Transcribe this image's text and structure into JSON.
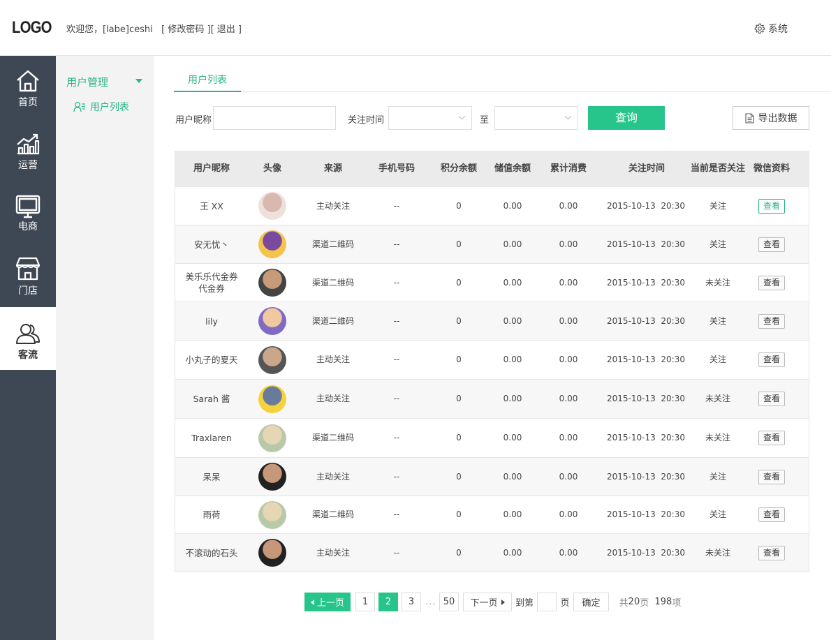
{
  "header": {
    "logo": "LOGO",
    "welcome": "欢迎您，[labe]ceshi",
    "change_password": "[ 修改密码 ]",
    "logout": "[ 退出 ]",
    "system": "系统"
  },
  "nav": {
    "items": [
      {
        "label": "首页",
        "icon": "home-icon"
      },
      {
        "label": "运营",
        "icon": "chart-icon"
      },
      {
        "label": "电商",
        "icon": "monitor-icon"
      },
      {
        "label": "门店",
        "icon": "store-icon"
      },
      {
        "label": "客流",
        "icon": "users-icon",
        "active": true
      }
    ]
  },
  "subnav": {
    "title": "用户管理",
    "item": "用户列表"
  },
  "tab": "用户列表",
  "filters": {
    "nickname_label": "用户昵称",
    "nickname_value": "",
    "time_label": "关注时间",
    "to_label": "至",
    "query_button": "查询",
    "export_button": "导出数据"
  },
  "table": {
    "headers": [
      "用户昵称",
      "头像",
      "来源",
      "手机号码",
      "积分余额",
      "储值余额",
      "累计消费",
      "关注时间",
      "当前是否关注",
      "微信资料"
    ],
    "rows": [
      {
        "name": "王 XX",
        "source": "主动关注",
        "phone": "--",
        "points": "0",
        "balance": "0.00",
        "spent": "0.00",
        "time": "2015-10-13  20:30",
        "follow": "关注",
        "action": "查看"
      },
      {
        "name": "安无忧丶",
        "source": "渠道二维码",
        "phone": "--",
        "points": "0",
        "balance": "0.00",
        "spent": "0.00",
        "time": "2015-10-13  20:30",
        "follow": "关注",
        "action": "查看"
      },
      {
        "name": "美乐乐代金券代金券",
        "source": "渠道二维码",
        "phone": "--",
        "points": "0",
        "balance": "0.00",
        "spent": "0.00",
        "time": "2015-10-13  20:30",
        "follow": "未关注",
        "action": "查看"
      },
      {
        "name": "lily",
        "source": "渠道二维码",
        "phone": "--",
        "points": "0",
        "balance": "0.00",
        "spent": "0.00",
        "time": "2015-10-13  20:30",
        "follow": "关注",
        "action": "查看"
      },
      {
        "name": "小丸子的夏天",
        "source": "主动关注",
        "phone": "--",
        "points": "0",
        "balance": "0.00",
        "spent": "0.00",
        "time": "2015-10-13  20:30",
        "follow": "关注",
        "action": "查看"
      },
      {
        "name": "Sarah 酱",
        "source": "主动关注",
        "phone": "--",
        "points": "0",
        "balance": "0.00",
        "spent": "0.00",
        "time": "2015-10-13  20:30",
        "follow": "未关注",
        "action": "查看"
      },
      {
        "name": "Traxlaren",
        "source": "渠道二维码",
        "phone": "--",
        "points": "0",
        "balance": "0.00",
        "spent": "0.00",
        "time": "2015-10-13  20:30",
        "follow": "未关注",
        "action": "查看"
      },
      {
        "name": "呆呆",
        "source": "主动关注",
        "phone": "--",
        "points": "0",
        "balance": "0.00",
        "spent": "0.00",
        "time": "2015-10-13  20:30",
        "follow": "关注",
        "action": "查看"
      },
      {
        "name": "雨荷",
        "source": "渠道二维码",
        "phone": "--",
        "points": "0",
        "balance": "0.00",
        "spent": "0.00",
        "time": "2015-10-13  20:30",
        "follow": "关注",
        "action": "查看"
      },
      {
        "name": "不滚动的石头",
        "source": "主动关注",
        "phone": "--",
        "points": "0",
        "balance": "0.00",
        "spent": "0.00",
        "time": "2015-10-13  20:30",
        "follow": "未关注",
        "action": "查看"
      }
    ]
  },
  "pagination": {
    "prev": "上一页",
    "pages": [
      "1",
      "2",
      "3"
    ],
    "current": "2",
    "ellipsis": "...",
    "last": "50",
    "next": "下一页",
    "goto_label": "到第",
    "goto_value": "",
    "page_unit": "页",
    "confirm": "确定",
    "total_prefix": "共",
    "total_pages": "20",
    "total_pages_unit": "页",
    "total_items": "198",
    "total_items_unit": "项"
  },
  "colors": {
    "accent": "#27c48c",
    "nav_bg": "#3e4754"
  }
}
